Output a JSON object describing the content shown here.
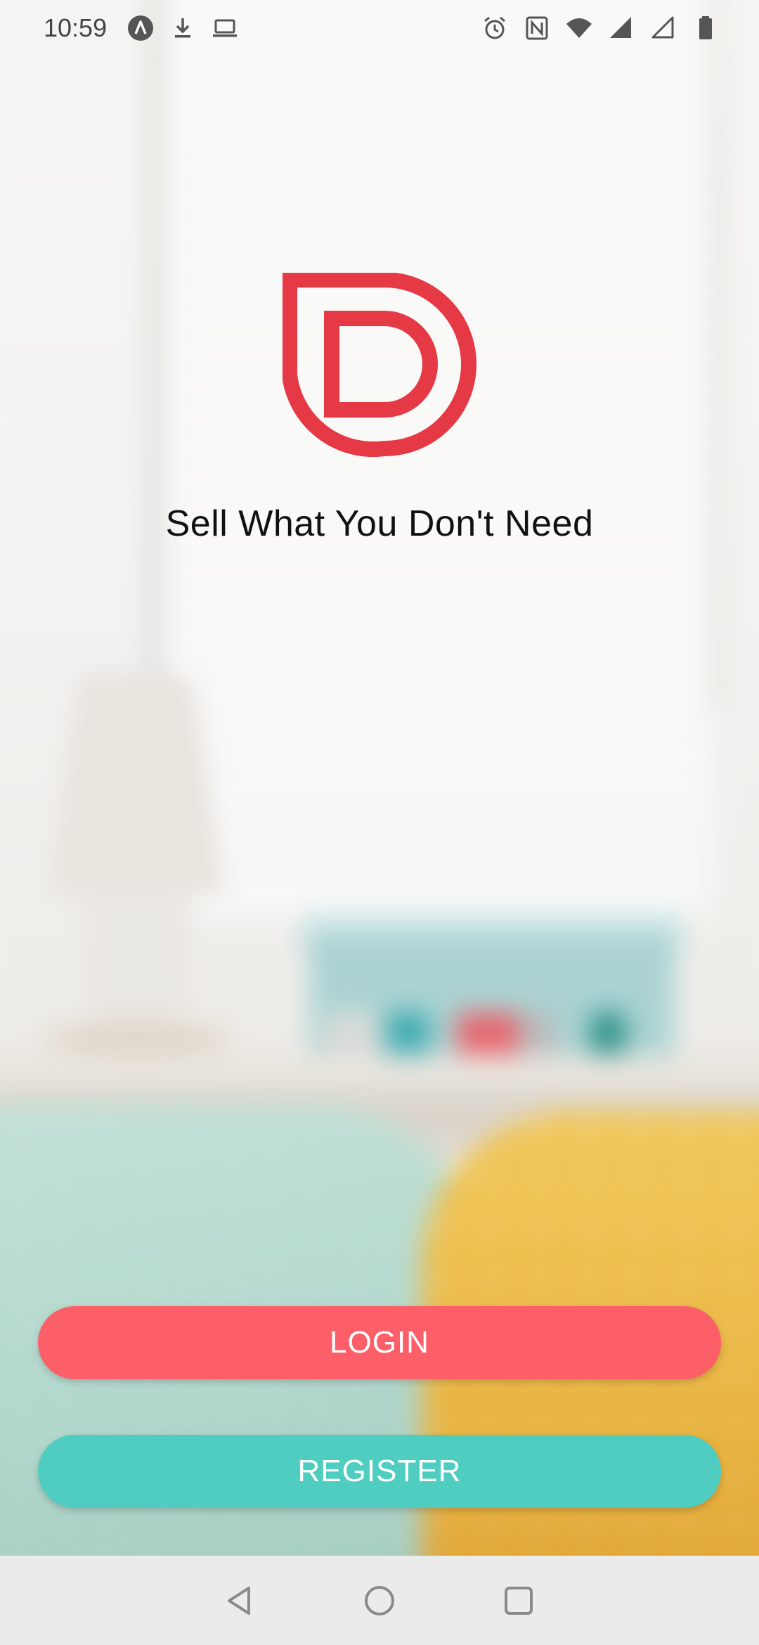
{
  "status_bar": {
    "time": "10:59",
    "left_icons": [
      "app-notification-icon",
      "download-icon",
      "laptop-icon"
    ],
    "right_icons": [
      "alarm-icon",
      "nfc-icon",
      "wifi-icon",
      "signal-icon",
      "signal-empty-icon",
      "battery-icon"
    ]
  },
  "brand": {
    "logo_icon": "d-logo-icon",
    "logo_color": "#e63946",
    "tagline": "Sell What You Don't Need"
  },
  "actions": {
    "login_label": "LOGIN",
    "login_color": "#fd5f69",
    "register_label": "REGISTER",
    "register_color": "#4fcdc1"
  },
  "nav_bar": {
    "buttons": [
      "back-icon",
      "home-icon",
      "recents-icon"
    ]
  }
}
